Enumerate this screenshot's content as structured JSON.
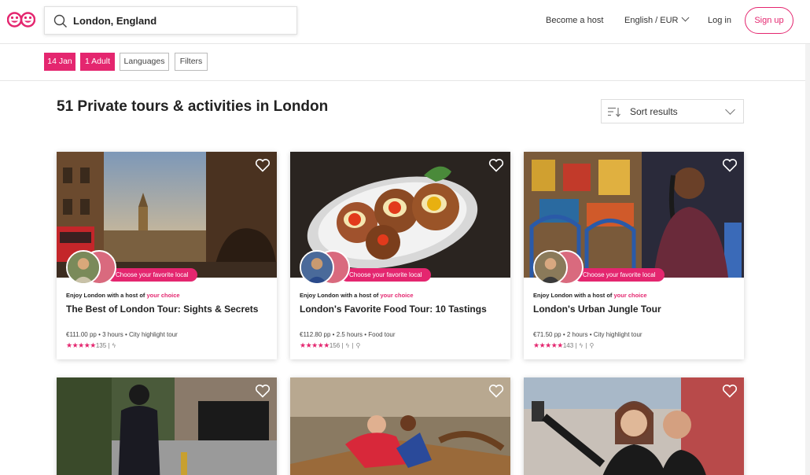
{
  "header": {
    "search_value": "London, England",
    "become_host": "Become a host",
    "language": "English / EUR",
    "login": "Log in",
    "signup": "Sign up"
  },
  "filters": {
    "date": "14 Jan",
    "guests": "1 Adult",
    "languages": "Languages",
    "filters": "Filters"
  },
  "page_title": "51 Private tours & activities in London",
  "sort_label": "Sort results",
  "brand_color": "#e4266f",
  "cards": [
    {
      "badge": "Choose your favorite local",
      "host_prefix": "Enjoy London with a host of",
      "host_choice": "your choice",
      "title": "The Best of London Tour: Sights & Secrets",
      "meta": "€111.00 pp • 3 hours • City highlight tour",
      "stars": "★★★★★",
      "reviews": "135",
      "icons": [
        "lightning-icon"
      ]
    },
    {
      "badge": "Choose your favorite local",
      "host_prefix": "Enjoy London with a host of",
      "host_choice": "your choice",
      "title": "London's Favorite Food Tour: 10 Tastings",
      "meta": "€112.80 pp • 2.5 hours • Food tour",
      "stars": "★★★★★",
      "reviews": "156",
      "icons": [
        "lightning-icon",
        "walking-icon"
      ]
    },
    {
      "badge": "Choose your favorite local",
      "host_prefix": "Enjoy London with a host of",
      "host_choice": "your choice",
      "title": "London's Urban Jungle Tour",
      "meta": "€71.50 pp • 2 hours • City highlight tour",
      "stars": "★★★★★",
      "reviews": "143",
      "icons": [
        "lightning-icon",
        "walking-icon"
      ]
    }
  ]
}
